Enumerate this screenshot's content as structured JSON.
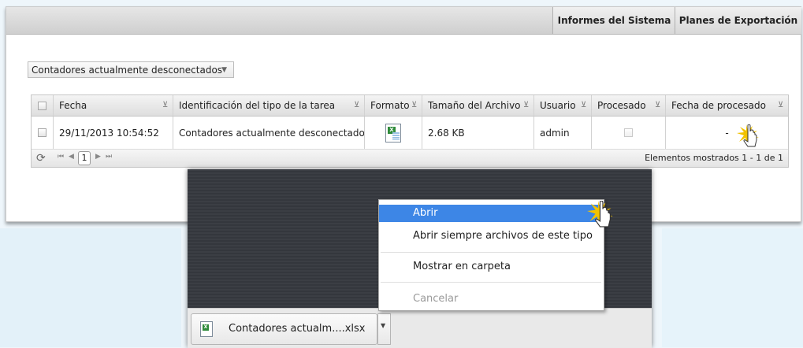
{
  "topbar": {
    "tabs": [
      {
        "label": "Informes del Sistema"
      },
      {
        "label": "Planes de Exportación"
      }
    ]
  },
  "filter_dropdown": {
    "value": "Contadores actualmente desconectados"
  },
  "grid": {
    "columns": [
      "Fecha",
      "Identificación del tipo de la tarea",
      "Formato",
      "Tamaño del Archivo",
      "Usuario",
      "Procesado",
      "Fecha de procesado"
    ],
    "rows": [
      {
        "fecha": "29/11/2013 10:54:52",
        "tipo": "Contadores actualmente desconectados",
        "formato_icon": "excel-file-icon",
        "tamano": "2.68 KB",
        "usuario": "admin",
        "procesado": false,
        "fecha_procesado": "-"
      }
    ],
    "pager": {
      "page": "1",
      "summary": "Elementos mostrados 1 - 1 de 1"
    }
  },
  "context_menu": {
    "items": [
      "Abrir",
      "Abrir siempre archivos de este tipo",
      "Mostrar en carpeta",
      "Cancelar"
    ]
  },
  "download": {
    "filename": "Contadores actualm....xlsx"
  },
  "colors": {
    "menu_highlight": "#3d86e6",
    "cursor_burst": "#f2c200"
  }
}
